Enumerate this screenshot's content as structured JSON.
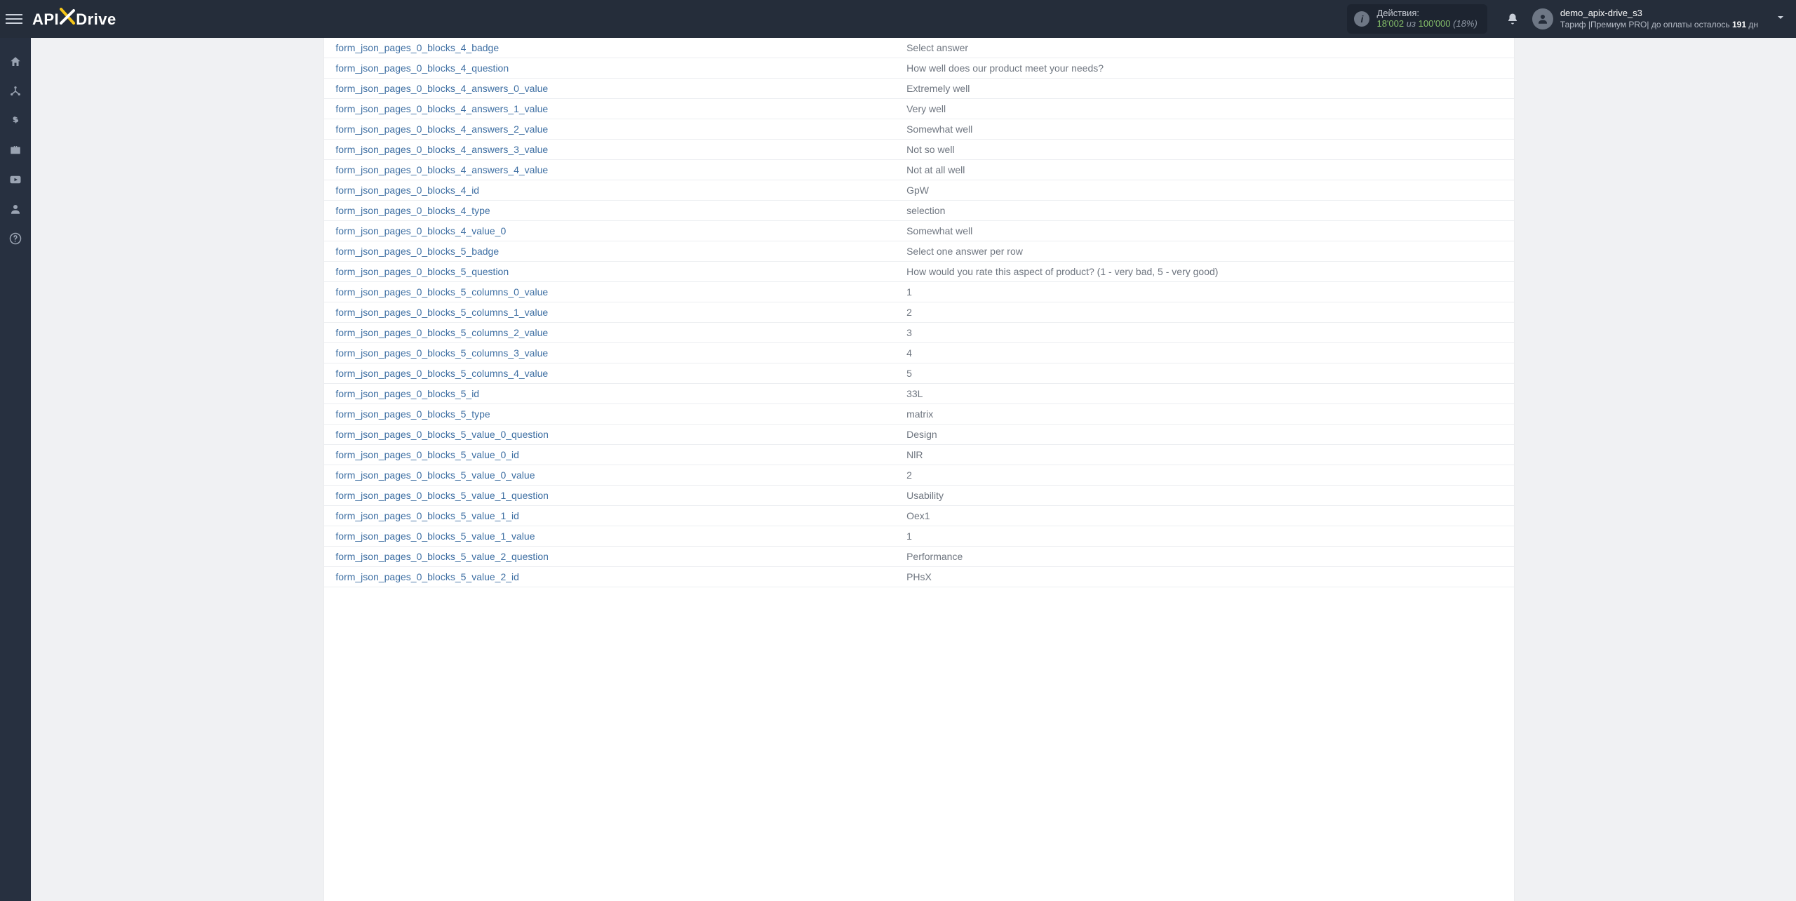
{
  "header": {
    "logo": {
      "part1": "API",
      "part2": "Drive"
    },
    "actions": {
      "label": "Действия:",
      "used": "18'002",
      "of_word": "из",
      "total": "100'000",
      "percent": "(18%)"
    },
    "user": {
      "name": "demo_apix-drive_s3",
      "tariff_prefix": "Тариф |",
      "tariff_plan": "Премиум PRO",
      "tariff_sep": "| до оплаты осталось ",
      "days": "191",
      "days_suffix": " дн"
    }
  },
  "rows": [
    {
      "k": "form_json_pages_0_blocks_4_badge",
      "v": "Select answer"
    },
    {
      "k": "form_json_pages_0_blocks_4_question",
      "v": "How well does our product meet your needs?"
    },
    {
      "k": "form_json_pages_0_blocks_4_answers_0_value",
      "v": "Extremely well"
    },
    {
      "k": "form_json_pages_0_blocks_4_answers_1_value",
      "v": "Very well"
    },
    {
      "k": "form_json_pages_0_blocks_4_answers_2_value",
      "v": "Somewhat well"
    },
    {
      "k": "form_json_pages_0_blocks_4_answers_3_value",
      "v": "Not so well"
    },
    {
      "k": "form_json_pages_0_blocks_4_answers_4_value",
      "v": "Not at all well"
    },
    {
      "k": "form_json_pages_0_blocks_4_id",
      "v": "GpW"
    },
    {
      "k": "form_json_pages_0_blocks_4_type",
      "v": "selection"
    },
    {
      "k": "form_json_pages_0_blocks_4_value_0",
      "v": "Somewhat well"
    },
    {
      "k": "form_json_pages_0_blocks_5_badge",
      "v": "Select one answer per row"
    },
    {
      "k": "form_json_pages_0_blocks_5_question",
      "v": "How would you rate this aspect of product? (1 - very bad, 5 - very good)"
    },
    {
      "k": "form_json_pages_0_blocks_5_columns_0_value",
      "v": "1"
    },
    {
      "k": "form_json_pages_0_blocks_5_columns_1_value",
      "v": "2"
    },
    {
      "k": "form_json_pages_0_blocks_5_columns_2_value",
      "v": "3"
    },
    {
      "k": "form_json_pages_0_blocks_5_columns_3_value",
      "v": "4"
    },
    {
      "k": "form_json_pages_0_blocks_5_columns_4_value",
      "v": "5"
    },
    {
      "k": "form_json_pages_0_blocks_5_id",
      "v": "33L"
    },
    {
      "k": "form_json_pages_0_blocks_5_type",
      "v": "matrix"
    },
    {
      "k": "form_json_pages_0_blocks_5_value_0_question",
      "v": "Design"
    },
    {
      "k": "form_json_pages_0_blocks_5_value_0_id",
      "v": "NlR"
    },
    {
      "k": "form_json_pages_0_blocks_5_value_0_value",
      "v": "2"
    },
    {
      "k": "form_json_pages_0_blocks_5_value_1_question",
      "v": "Usability"
    },
    {
      "k": "form_json_pages_0_blocks_5_value_1_id",
      "v": "Oex1"
    },
    {
      "k": "form_json_pages_0_blocks_5_value_1_value",
      "v": "1"
    },
    {
      "k": "form_json_pages_0_blocks_5_value_2_question",
      "v": "Performance"
    },
    {
      "k": "form_json_pages_0_blocks_5_value_2_id",
      "v": "PHsX"
    }
  ]
}
